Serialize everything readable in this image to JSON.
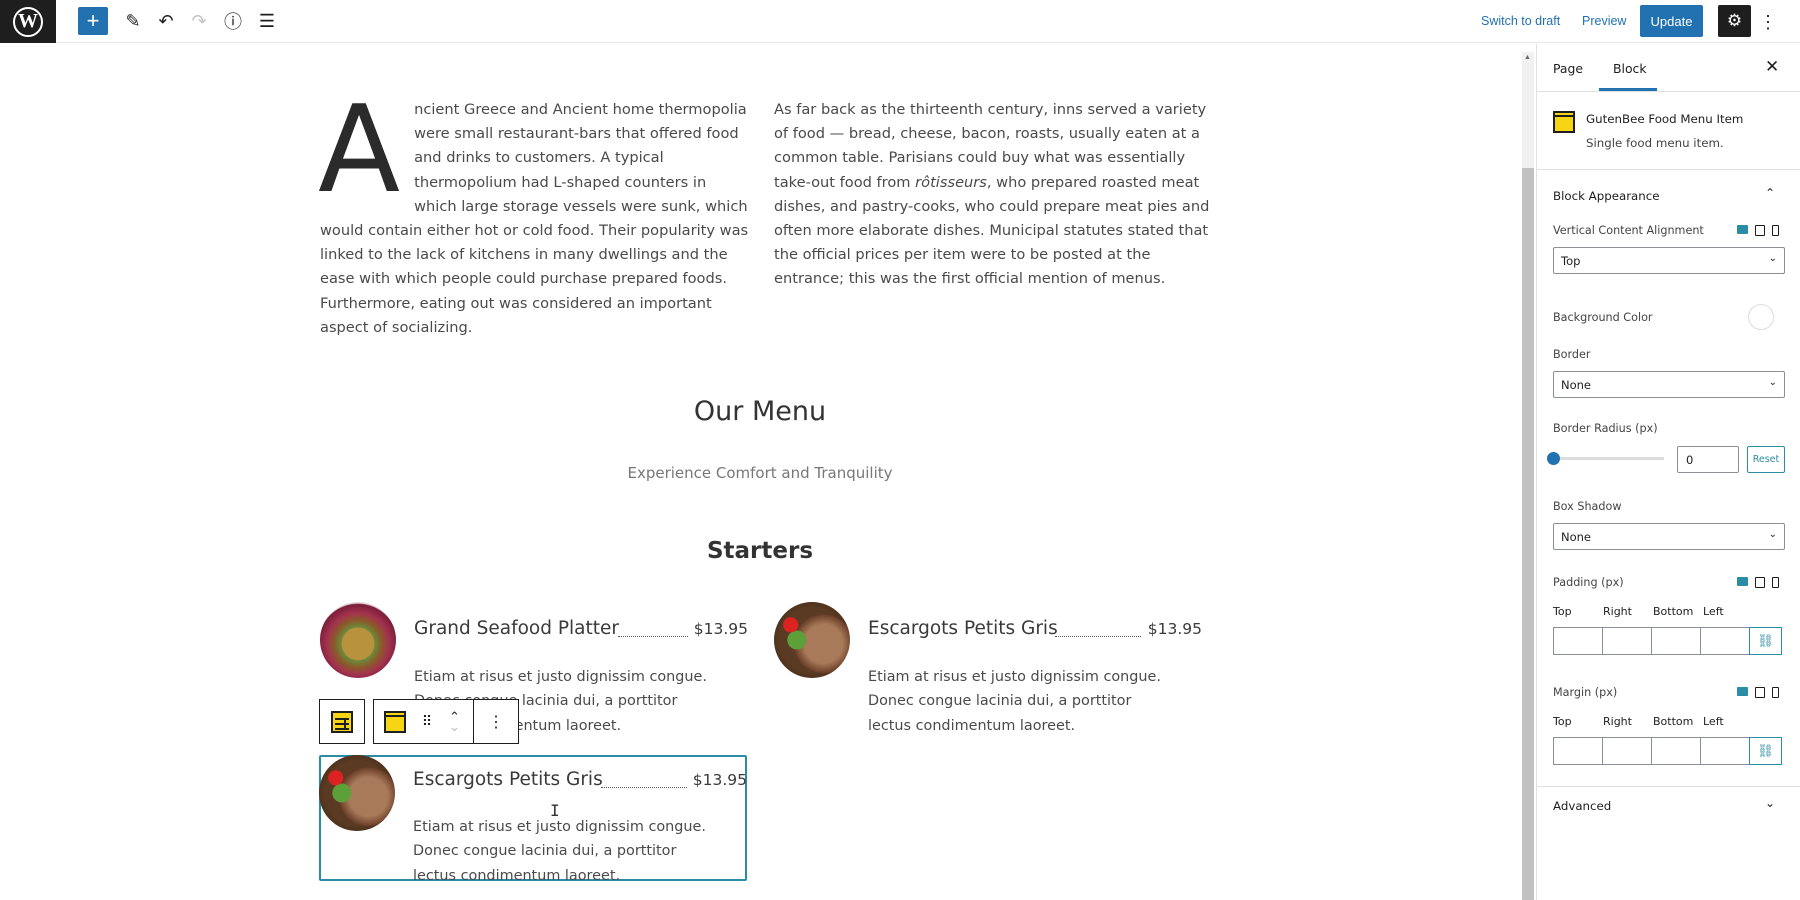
{
  "topbar": {
    "logo_letter": "W",
    "add_icon": "+",
    "edit_icon": "✎",
    "undo_icon": "↶",
    "redo_icon": "↷",
    "info_icon": "ⓘ",
    "list_view_icon": "☰",
    "switch_to_draft": "Switch to draft",
    "preview": "Preview",
    "update": "Update",
    "settings_icon": "⚙",
    "more_icon": "⋮"
  },
  "content": {
    "left_column": {
      "dropcap": "A",
      "lines_beside_dropcap": [
        "ncient Greece and Ancient",
        "home thermopolia were small restaurant-bars",
        "that offered food and drinks to customers. A",
        "typical thermopolium had L-shaped counters",
        "in which large storage vessels were sunk,"
      ],
      "rest": "which would contain either hot or cold food. Their popularity was linked to the lack of kitchens in many dwellings and the ease with which people could purchase prepared foods. Furthermore, eating out was considered an important aspect of socializing."
    },
    "right_column": {
      "before_italic": "As far back as the thirteenth century, inns served a variety of food — bread, cheese, bacon, roasts, usually eaten at a common table. Parisians could buy what was essentially take-out food from ",
      "italic": "rôtisseurs",
      "after_italic": ", who prepared roasted meat dishes, and pastry-cooks, who could prepare meat pies and often more elaborate dishes. Municipal statutes stated that the official prices per item were to be posted at the entrance; this was the first official mention of menus."
    },
    "menu_title": "Our Menu",
    "menu_subtitle": "Experience Comfort and Tranquility",
    "section_title": "Starters",
    "items": [
      {
        "name": "Grand Seafood Platter",
        "price": "$13.95",
        "description": "Etiam at risus et justo dignissim congue. Donec congue lacinia dui, a porttitor lectus condimentum laoreet.",
        "image": "seafood-platter"
      },
      {
        "name": "Escargots Petits Gris",
        "price": "$13.95",
        "description": "Etiam at risus et justo dignissim congue. Donec congue lacinia dui, a porttitor lectus condimentum laoreet.",
        "image": "grilled-steak"
      },
      {
        "name": "Escargots Petits Gris",
        "price": "$13.95",
        "description": "Etiam at risus et justo dignissim congue. Donec congue lacinia dui, a porttitor lectus condimentum laoreet.",
        "image": "grilled-steak",
        "selected": true
      }
    ],
    "block_toolbar": {
      "parent_icon": "food-menu-table-icon",
      "block_icon": "food-menu-item-icon",
      "drag_icon": "⠿",
      "move_up": "⌃",
      "move_down": "⌄",
      "options_icon": "⋮"
    },
    "cursor_glyph": "I"
  },
  "sidebar": {
    "tabs": [
      {
        "label": "Page",
        "active": false
      },
      {
        "label": "Block",
        "active": true
      }
    ],
    "close_icon": "✕",
    "block": {
      "name": "GutenBee Food Menu Item",
      "description": "Single food menu item."
    },
    "panels": {
      "appearance": {
        "title": "Block Appearance",
        "expanded": true,
        "vertical_alignment": {
          "label": "Vertical Content Alignment",
          "value": "Top"
        },
        "background_color": {
          "label": "Background Color"
        },
        "border": {
          "label": "Border",
          "value": "None"
        },
        "border_radius": {
          "label": "Border Radius (px)",
          "value": "0",
          "reset": "Reset"
        },
        "box_shadow": {
          "label": "Box Shadow",
          "value": "None"
        },
        "padding": {
          "label": "Padding (px)",
          "sides": [
            "Top",
            "Right",
            "Bottom",
            "Left"
          ]
        },
        "margin": {
          "label": "Margin (px)",
          "sides": [
            "Top",
            "Right",
            "Bottom",
            "Left"
          ]
        }
      },
      "advanced": {
        "title": "Advanced",
        "expanded": false
      }
    },
    "chevron_up": "⌃",
    "chevron_down": "⌄",
    "select_caret": "⌄",
    "link_icon": "🔗"
  },
  "colors": {
    "accent": "#2271b1",
    "selection": "#2b8ca6",
    "block_icon_yellow": "#f6d614",
    "dark": "#1e1e1e"
  }
}
